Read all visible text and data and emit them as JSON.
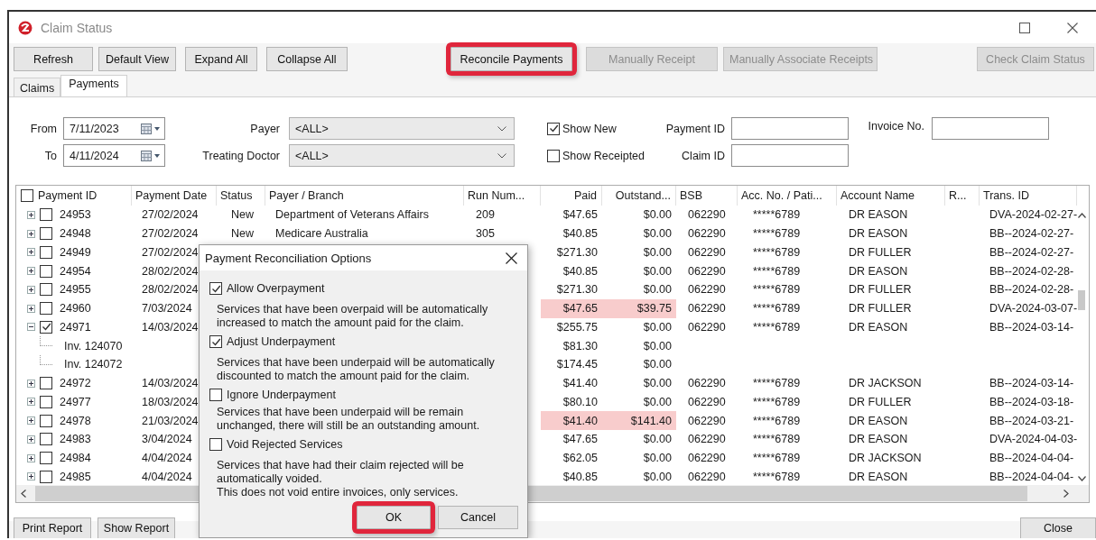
{
  "window": {
    "title": "Claim Status"
  },
  "toolbar": [
    {
      "label": "Refresh",
      "disabled": false,
      "highlighted": false
    },
    {
      "label": "Default View",
      "disabled": false,
      "highlighted": false
    },
    {
      "label": "Expand All",
      "disabled": false,
      "highlighted": false
    },
    {
      "label": "Collapse All",
      "disabled": false,
      "highlighted": false
    },
    {
      "label": "Reconcile Payments",
      "disabled": false,
      "highlighted": true
    },
    {
      "label": "Manually Receipt",
      "disabled": true,
      "highlighted": false
    },
    {
      "label": "Manually Associate Receipts",
      "disabled": true,
      "highlighted": false
    },
    {
      "label": "Check Claim Status",
      "disabled": true,
      "highlighted": false
    }
  ],
  "tabs": [
    {
      "label": "Claims",
      "selected": false
    },
    {
      "label": "Payments",
      "selected": true
    }
  ],
  "filters": {
    "from": {
      "label": "From",
      "value": "7/11/2023"
    },
    "to": {
      "label": "To",
      "value": "4/11/2024"
    },
    "payer": {
      "label": "Payer",
      "value": "<ALL>"
    },
    "treating_doctor": {
      "label": "Treating Doctor",
      "value": "<ALL>"
    },
    "show_new": {
      "label": "Show New",
      "checked": true
    },
    "show_receipted": {
      "label": "Show Receipted",
      "checked": false
    },
    "payment_id": {
      "label": "Payment ID"
    },
    "claim_id": {
      "label": "Claim ID"
    },
    "invoice_no": {
      "label": "Invoice No."
    }
  },
  "table": {
    "select_all_checked": false,
    "columns": [
      "Payment ID",
      "Payment Date",
      "Status",
      "Payer / Branch",
      "Run Num...",
      "Paid",
      "Outstand...",
      "BSB",
      "Acc. No. / Pati...",
      "Account Name",
      "R...",
      "Trans. ID"
    ],
    "rows": [
      {
        "id": "24953",
        "checked": false,
        "expanded": false,
        "flagged": false,
        "date": "27/02/2024",
        "status": "New",
        "payer": "Department of Veterans Affairs",
        "run_number": "209",
        "paid": "$47.65",
        "outstanding": "$0.00",
        "bsb": "062290",
        "account": "*****6789",
        "account_name": "DR EASON",
        "trans_id": "DVA-2024-02-27-"
      },
      {
        "id": "24948",
        "checked": false,
        "expanded": false,
        "flagged": false,
        "date": "27/02/2024",
        "status": "New",
        "payer": "Medicare Australia",
        "run_number": "305",
        "paid": "$40.85",
        "outstanding": "$0.00",
        "bsb": "062290",
        "account": "*****6789",
        "account_name": "DR EASON",
        "trans_id": "BB--2024-02-27-"
      },
      {
        "id": "24949",
        "checked": false,
        "expanded": false,
        "flagged": false,
        "date": "27/02/2024",
        "paid": "$271.30",
        "outstanding": "$0.00",
        "bsb": "062290",
        "account": "*****6789",
        "account_name": "DR FULLER",
        "trans_id": "BB--2024-02-27-"
      },
      {
        "id": "24954",
        "checked": false,
        "expanded": false,
        "flagged": false,
        "date": "28/02/2024",
        "paid": "$40.85",
        "outstanding": "$0.00",
        "bsb": "062290",
        "account": "*****6789",
        "account_name": "DR EASON",
        "trans_id": "BB--2024-02-28-"
      },
      {
        "id": "24955",
        "checked": false,
        "expanded": false,
        "flagged": false,
        "date": "28/02/2024",
        "paid": "$271.30",
        "outstanding": "$0.00",
        "bsb": "062290",
        "account": "*****6789",
        "account_name": "DR FULLER",
        "trans_id": "BB--2024-02-28-"
      },
      {
        "id": "24960",
        "checked": false,
        "expanded": false,
        "flagged": true,
        "date": "7/03/2024",
        "paid": "$47.65",
        "outstanding": "$39.75",
        "bsb": "062290",
        "account": "*****6789",
        "account_name": "DR FULLER",
        "trans_id": "DVA-2024-03-07-"
      },
      {
        "id": "24971",
        "checked": true,
        "expanded": true,
        "flagged": false,
        "date": "14/03/2024",
        "paid": "$255.75",
        "outstanding": "$0.00",
        "bsb": "062290",
        "account": "*****6789",
        "account_name": "DR EASON",
        "trans_id": "BB--2024-03-14-",
        "children": [
          {
            "label": "Inv. 124070",
            "paid": "$81.30",
            "outstanding": "$0.00"
          },
          {
            "label": "Inv. 124072",
            "paid": "$174.45",
            "outstanding": "$0.00"
          }
        ]
      },
      {
        "id": "24972",
        "checked": false,
        "expanded": false,
        "flagged": false,
        "date": "14/03/2024",
        "paid": "$41.40",
        "outstanding": "$0.00",
        "bsb": "062290",
        "account": "*****6789",
        "account_name": "DR JACKSON",
        "trans_id": "BB--2024-03-14-"
      },
      {
        "id": "24977",
        "checked": false,
        "expanded": false,
        "flagged": false,
        "date": "18/03/2024",
        "paid": "$80.10",
        "outstanding": "$0.00",
        "bsb": "062290",
        "account": "*****6789",
        "account_name": "DR FULLER",
        "trans_id": "BB--2024-03-18-"
      },
      {
        "id": "24978",
        "checked": false,
        "expanded": false,
        "flagged": true,
        "date": "21/03/2024",
        "paid": "$41.40",
        "outstanding": "$141.40",
        "bsb": "062290",
        "account": "*****6789",
        "account_name": "DR EASON",
        "trans_id": "BB--2024-03-21-"
      },
      {
        "id": "24983",
        "checked": false,
        "expanded": false,
        "flagged": false,
        "date": "3/04/2024",
        "paid": "$47.65",
        "outstanding": "$0.00",
        "bsb": "062290",
        "account": "*****6789",
        "account_name": "DR EASON",
        "trans_id": "DVA-2024-04-03-"
      },
      {
        "id": "24984",
        "checked": false,
        "expanded": false,
        "flagged": false,
        "date": "4/04/2024",
        "paid": "$62.05",
        "outstanding": "$0.00",
        "bsb": "062290",
        "account": "*****6789",
        "account_name": "DR JACKSON",
        "trans_id": "BB--2024-04-04-"
      },
      {
        "id": "24985",
        "checked": false,
        "expanded": false,
        "flagged": false,
        "date": "4/04/2024",
        "paid": "$40.85",
        "outstanding": "$0.00",
        "bsb": "062290",
        "account": "*****6789",
        "account_name": "DR EASON",
        "trans_id": "BB--2024-04-04-"
      }
    ]
  },
  "dialog": {
    "title": "Payment Reconciliation Options",
    "options": [
      {
        "label": "Allow Overpayment",
        "checked": true,
        "description": [
          "Services that have been overpaid will be automatically increased to match the amount paid for the claim."
        ]
      },
      {
        "label": "Adjust Underpayment",
        "checked": true,
        "description": [
          "Services that have been underpaid will be automatically discounted to match the amount paid for the claim."
        ]
      },
      {
        "label": "Ignore Underpayment",
        "checked": false,
        "description": [
          "Services that have been underpaid will be remain unchanged, there will still be an outstanding amount."
        ]
      },
      {
        "label": "Void Rejected Services",
        "checked": false,
        "description": [
          "Services that have had their claim rejected will be automatically voided.",
          "This does not void entire invoices, only services."
        ]
      }
    ],
    "buttons": [
      {
        "label": "OK",
        "highlighted": true
      },
      {
        "label": "Cancel",
        "highlighted": false
      }
    ]
  },
  "footer_buttons": [
    {
      "label": "Print Report"
    },
    {
      "label": "Show Report"
    },
    {
      "label": "Close"
    }
  ]
}
